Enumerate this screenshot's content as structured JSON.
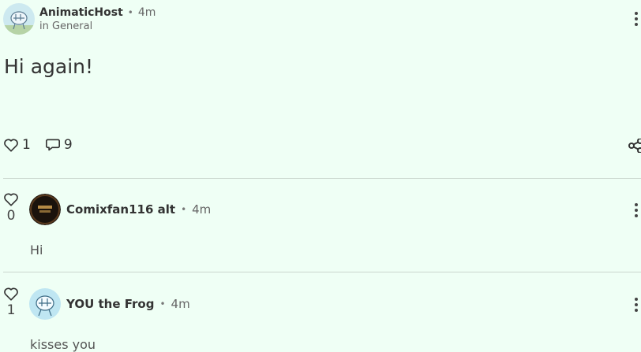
{
  "post": {
    "author": "AnimaticHost",
    "separator": "•",
    "time": "4m",
    "category": "in General",
    "body": "Hi again!",
    "like_count": "1",
    "comment_count": "9"
  },
  "comments": [
    {
      "vote_count": "0",
      "author": "Comixfan116 alt",
      "separator": "•",
      "time": "4m",
      "body": "Hi"
    },
    {
      "vote_count": "1",
      "author": "YOU the Frog",
      "separator": "•",
      "time": "4m",
      "body": "kisses you"
    }
  ],
  "colors": {
    "background": "#effff5",
    "text": "#333333",
    "divider": "#c9d6cd"
  },
  "icons": [
    "heart-icon",
    "comment-icon",
    "share-icon",
    "more-vert-icon"
  ]
}
